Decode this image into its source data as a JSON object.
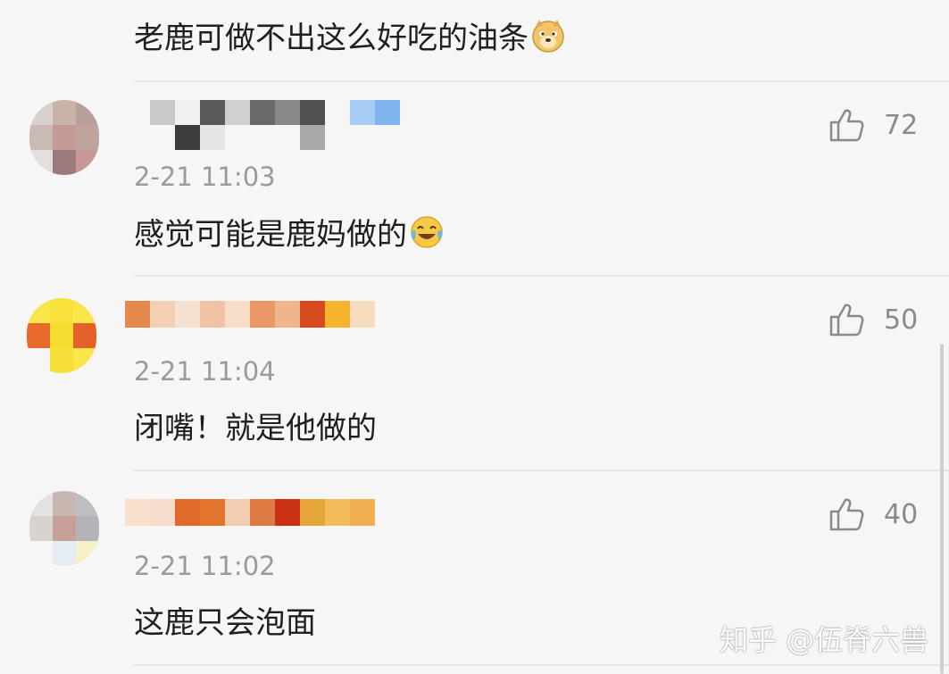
{
  "comments": [
    {
      "text": "老鹿可做不出这么好吃的油条",
      "emoji": "doge-emoji"
    },
    {
      "time": "2-21 11:03",
      "text": "感觉可能是鹿妈做的",
      "emoji": "laugh-cry-emoji",
      "likes": "72"
    },
    {
      "time": "2-21 11:04",
      "text": "闭嘴！就是他做的",
      "likes": "50"
    },
    {
      "time": "2-21 11:02",
      "text": "这鹿只会泡面",
      "likes": "40"
    }
  ],
  "watermark": "知乎 @伍脊六兽",
  "icons": {
    "like": "thumbs-up-icon"
  },
  "colors": {
    "background": "#f6f6f6",
    "divider": "#e6e6e6",
    "secondary_text": "#9a9a9a"
  }
}
